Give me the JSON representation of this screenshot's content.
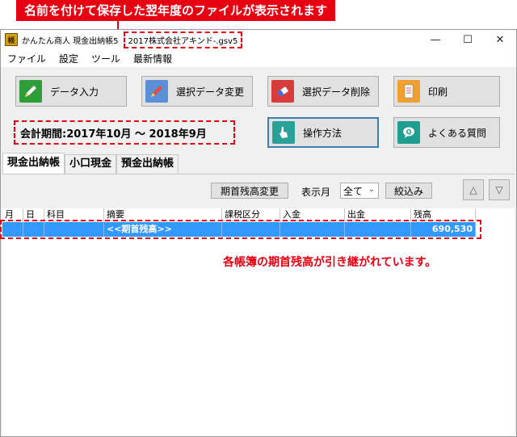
{
  "callout_top": "名前を付けて保存した翌年度のファイルが表示されます",
  "window": {
    "app_title": "かんたん商人 現金出納帳5",
    "file_name": "2017株式会社アキンド-.gsv5",
    "icon_label": "帳",
    "controls": {
      "minimize": "—",
      "maximize": "☐",
      "close": "✕"
    }
  },
  "menu": [
    "ファイル",
    "設定",
    "ツール",
    "最新情報"
  ],
  "toolbar": {
    "data_entry": "データ入力",
    "edit_selected": "選択データ変更",
    "delete_selected": "選択データ削除",
    "print": "印刷",
    "how_to": "操作方法",
    "faq": "よくある質問"
  },
  "period": "会計期間:2017年10月 ～ 2018年9月",
  "tabs": [
    "現金出納帳",
    "小口現金",
    "預金出納帳"
  ],
  "controls": {
    "change_opening_balance": "期首残高変更",
    "display_month_label": "表示月",
    "display_month_value": "全て",
    "filter": "絞込み"
  },
  "grid": {
    "headers": [
      "月",
      "日",
      "科目",
      "摘要",
      "課税区分",
      "入金",
      "出金",
      "残高"
    ],
    "row": {
      "month": "",
      "day": "",
      "account": "",
      "description": "<<期首残高>>",
      "tax": "",
      "deposit": "",
      "withdrawal": "",
      "balance": "690,530"
    }
  },
  "note": "各帳簿の期首残高が引き継がれています。",
  "colors": {
    "accent_red": "#e60012",
    "selection_blue": "#3399ff"
  }
}
